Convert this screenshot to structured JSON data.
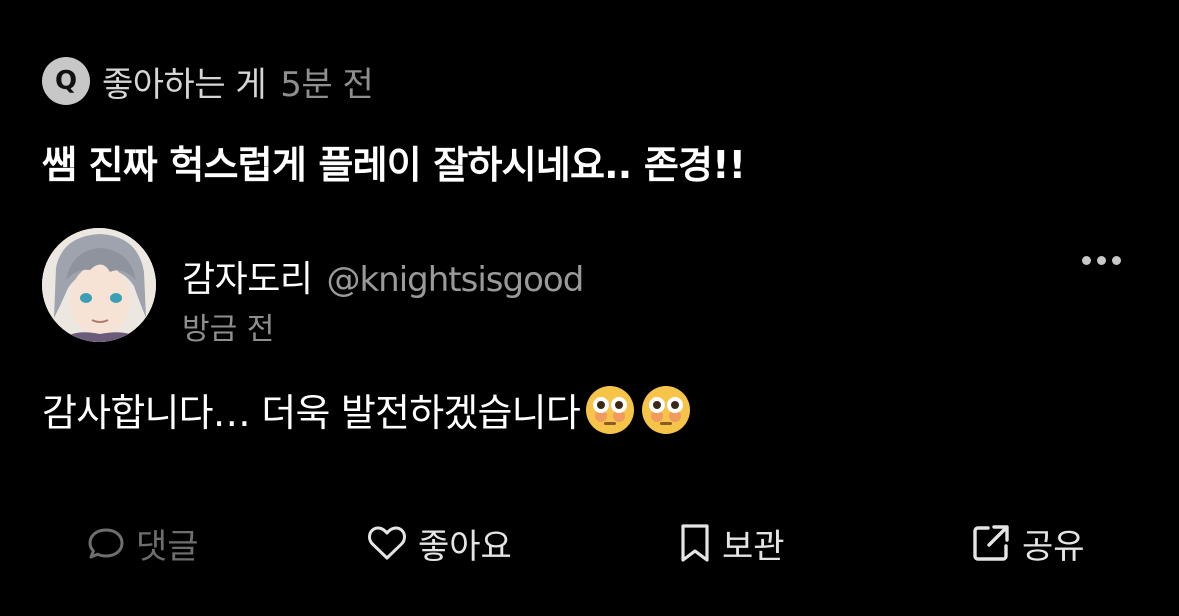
{
  "question_row": {
    "badge": "Q",
    "label": "좋아하는 게",
    "time": "5분 전"
  },
  "question": {
    "text": "쌤 진짜 헉스럽게 플레이 잘하시네요.. 존경!!"
  },
  "reply_header": {
    "name": "감자도리",
    "handle": "@knightsisgood",
    "time": "방금 전"
  },
  "reply": {
    "text": "감사합니다… 더욱 발전하겠습니다",
    "emojis": [
      "flushed-face-emoji",
      "flushed-face-emoji"
    ]
  },
  "actions": {
    "comment": "댓글",
    "like": "좋아요",
    "save": "보관",
    "share": "공유"
  },
  "colors": {
    "background": "#000000",
    "text_primary": "#ffffff",
    "text_secondary": "#8f8f8f",
    "badge": "#c7c7c7",
    "disabled_action": "#6e6e6e"
  }
}
